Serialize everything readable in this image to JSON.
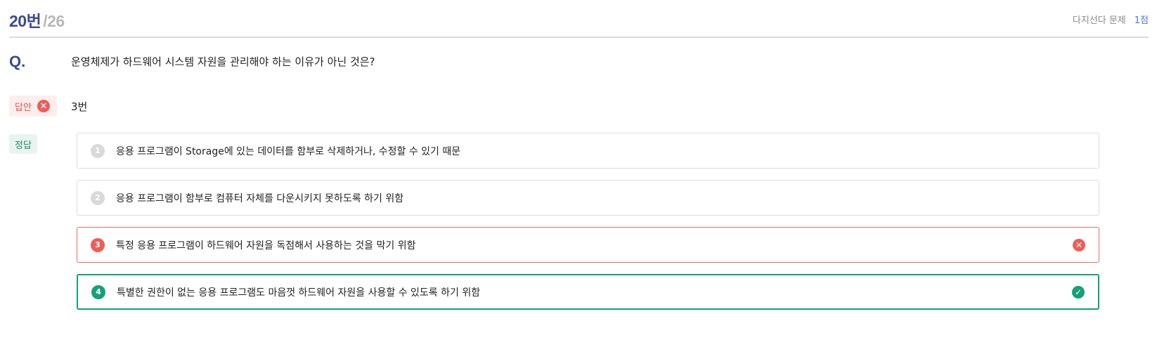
{
  "header": {
    "current": "20번",
    "total": "/26",
    "type_label": "다지선다 문제",
    "points": "1점"
  },
  "question": {
    "mark": "Q.",
    "text": "운영체제가 하드웨어 시스템 자원을 관리해야 하는 이유가 아닌 것은?"
  },
  "answer": {
    "label": "답안",
    "value": "3번",
    "status_icon": "x-circle-icon"
  },
  "correct": {
    "label": "정답"
  },
  "choices": [
    {
      "num": "1",
      "text": "응용 프로그램이 Storage에 있는 데이터를 함부로 삭제하거나, 수정할 수 있기 때문",
      "state": "normal"
    },
    {
      "num": "2",
      "text": "응용 프로그램이 함부로 컴퓨터 자체를 다운시키지 못하도록 하기 위함",
      "state": "normal"
    },
    {
      "num": "3",
      "text": "특정 응용 프로그램이 하드웨어 자원을 독점해서 사용하는 것을 막기 위함",
      "state": "wrong",
      "icon": "x-circle-icon"
    },
    {
      "num": "4",
      "text": "특별한 권한이 없는 응용 프로그램도 마음껏 하드웨어 자원을 사용할 수 있도록 하기 위함",
      "state": "correct",
      "icon": "check-circle-icon"
    }
  ],
  "colors": {
    "accent": "#3d4a8f",
    "wrong": "#ef5d56",
    "correct": "#14a07a"
  }
}
